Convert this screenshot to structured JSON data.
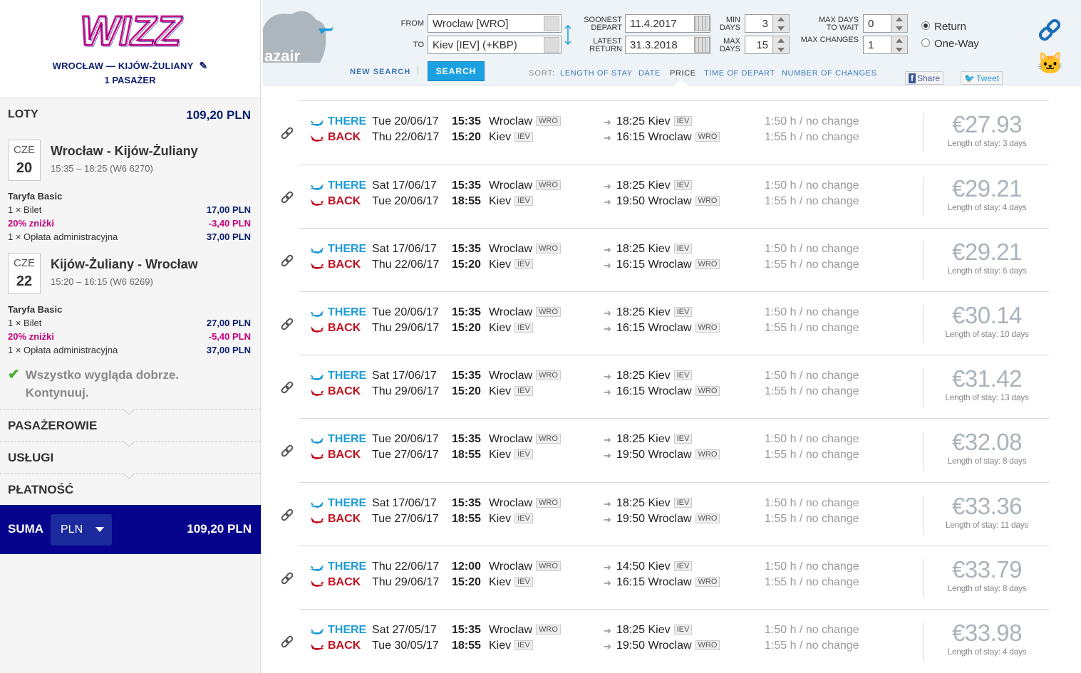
{
  "wizz": {
    "logo_text": "WIZZ",
    "route": "WROCŁAW — KIJÓW-ŻULIANY",
    "passengers": "1 PASAŻER",
    "flights_label": "LOTY",
    "flights_total": "109,20 PLN",
    "legs": [
      {
        "dow": "CZE",
        "day": "20",
        "title": "Wrocław - Kijów-Żuliany",
        "subtitle": "15:35 – 18:25 (W6 6270)",
        "fare_name": "Taryfa Basic",
        "lines": [
          {
            "label": "1 × Bilet",
            "value": "17,00 PLN"
          },
          {
            "label": "20% zniżki",
            "value": "-3,40 PLN"
          },
          {
            "label": "1 × Opłata administracyjna",
            "value": "37,00 PLN"
          }
        ]
      },
      {
        "dow": "CZE",
        "day": "22",
        "title": "Kijów-Żuliany - Wrocław",
        "subtitle": "15:20 – 16:15 (W6 6269)",
        "fare_name": "Taryfa Basic",
        "lines": [
          {
            "label": "1 × Bilet",
            "value": "27,00 PLN"
          },
          {
            "label": "20% zniżki",
            "value": "-5,40 PLN"
          },
          {
            "label": "1 × Opłata administracyjna",
            "value": "37,00 PLN"
          }
        ]
      }
    ],
    "ok_message_1": "Wszystko wygląda dobrze.",
    "ok_message_2": "Kontynuuj.",
    "sections": [
      "PASAŻEROWIE",
      "USŁUGI",
      "PŁATNOŚĆ"
    ],
    "suma_label": "SUMA",
    "currency": "PLN",
    "suma_total": "109,20 PLN",
    "brand_color": "#06038d",
    "accent_color": "#c6007e"
  },
  "search": {
    "logo_text": "azair",
    "from_label": "FROM",
    "from_value": "Wroclaw [WRO]",
    "to_label": "TO",
    "to_value": "Kiev [IEV] (+KBP)",
    "soonest_label_1": "SOONEST",
    "soonest_label_2": "DEPART",
    "soonest_value": "11.4.2017",
    "latest_label_1": "LATEST",
    "latest_label_2": "RETURN",
    "latest_value": "31.3.2018",
    "min_days_label_1": "MIN",
    "min_days_label_2": "DAYS",
    "min_days": "3",
    "max_days_label_1": "MAX",
    "max_days_label_2": "DAYS",
    "max_days": "15",
    "max_wait_label_1": "MAX DAYS",
    "max_wait_label_2": "TO WAIT",
    "max_wait": "0",
    "max_changes_label": "MAX CHANGES",
    "max_changes": "1",
    "radio_return": "Return",
    "radio_oneway": "One-Way",
    "new_search": "NEW SEARCH",
    "search_button": "SEARCH",
    "sort_label": "SORT:",
    "sort_items": [
      "LENGTH OF STAY",
      "DATE",
      "PRICE",
      "TIME OF DEPART",
      "NUMBER OF CHANGES"
    ],
    "share_label": "Share",
    "tweet_label": "Tweet"
  },
  "results": [
    {
      "there": {
        "date": "Tue 20/06/17",
        "time": "15:35",
        "from": "Wroclaw",
        "from_code": "WRO",
        "atime": "18:25",
        "to": "Kiev",
        "to_code": "IEV",
        "dur": "1:50 h / no change"
      },
      "back": {
        "date": "Thu 22/06/17",
        "time": "15:20",
        "from": "Kiev",
        "from_code": "IEV",
        "atime": "16:15",
        "to": "Wroclaw",
        "to_code": "WRO",
        "dur": "1:55 h / no change"
      },
      "price": "€27.93",
      "stay": "Length of stay: 3 days"
    },
    {
      "there": {
        "date": "Sat 17/06/17",
        "time": "15:35",
        "from": "Wroclaw",
        "from_code": "WRO",
        "atime": "18:25",
        "to": "Kiev",
        "to_code": "IEV",
        "dur": "1:50 h / no change"
      },
      "back": {
        "date": "Tue 20/06/17",
        "time": "18:55",
        "from": "Kiev",
        "from_code": "IEV",
        "atime": "19:50",
        "to": "Wroclaw",
        "to_code": "WRO",
        "dur": "1:55 h / no change"
      },
      "price": "€29.21",
      "stay": "Length of stay: 4 days"
    },
    {
      "there": {
        "date": "Sat 17/06/17",
        "time": "15:35",
        "from": "Wroclaw",
        "from_code": "WRO",
        "atime": "18:25",
        "to": "Kiev",
        "to_code": "IEV",
        "dur": "1:50 h / no change"
      },
      "back": {
        "date": "Thu 22/06/17",
        "time": "15:20",
        "from": "Kiev",
        "from_code": "IEV",
        "atime": "16:15",
        "to": "Wroclaw",
        "to_code": "WRO",
        "dur": "1:55 h / no change"
      },
      "price": "€29.21",
      "stay": "Length of stay: 6 days"
    },
    {
      "there": {
        "date": "Tue 20/06/17",
        "time": "15:35",
        "from": "Wroclaw",
        "from_code": "WRO",
        "atime": "18:25",
        "to": "Kiev",
        "to_code": "IEV",
        "dur": "1:50 h / no change"
      },
      "back": {
        "date": "Thu 29/06/17",
        "time": "15:20",
        "from": "Kiev",
        "from_code": "IEV",
        "atime": "16:15",
        "to": "Wroclaw",
        "to_code": "WRO",
        "dur": "1:55 h / no change"
      },
      "price": "€30.14",
      "stay": "Length of stay: 10 days"
    },
    {
      "there": {
        "date": "Sat 17/06/17",
        "time": "15:35",
        "from": "Wroclaw",
        "from_code": "WRO",
        "atime": "18:25",
        "to": "Kiev",
        "to_code": "IEV",
        "dur": "1:50 h / no change"
      },
      "back": {
        "date": "Thu 29/06/17",
        "time": "15:20",
        "from": "Kiev",
        "from_code": "IEV",
        "atime": "16:15",
        "to": "Wroclaw",
        "to_code": "WRO",
        "dur": "1:55 h / no change"
      },
      "price": "€31.42",
      "stay": "Length of stay: 13 days"
    },
    {
      "there": {
        "date": "Tue 20/06/17",
        "time": "15:35",
        "from": "Wroclaw",
        "from_code": "WRO",
        "atime": "18:25",
        "to": "Kiev",
        "to_code": "IEV",
        "dur": "1:50 h / no change"
      },
      "back": {
        "date": "Tue 27/06/17",
        "time": "18:55",
        "from": "Kiev",
        "from_code": "IEV",
        "atime": "19:50",
        "to": "Wroclaw",
        "to_code": "WRO",
        "dur": "1:55 h / no change"
      },
      "price": "€32.08",
      "stay": "Length of stay: 8 days"
    },
    {
      "there": {
        "date": "Sat 17/06/17",
        "time": "15:35",
        "from": "Wroclaw",
        "from_code": "WRO",
        "atime": "18:25",
        "to": "Kiev",
        "to_code": "IEV",
        "dur": "1:50 h / no change"
      },
      "back": {
        "date": "Tue 27/06/17",
        "time": "18:55",
        "from": "Kiev",
        "from_code": "IEV",
        "atime": "19:50",
        "to": "Wroclaw",
        "to_code": "WRO",
        "dur": "1:55 h / no change"
      },
      "price": "€33.36",
      "stay": "Length of stay: 11 days"
    },
    {
      "there": {
        "date": "Thu 22/06/17",
        "time": "12:00",
        "from": "Wroclaw",
        "from_code": "WRO",
        "atime": "14:50",
        "to": "Kiev",
        "to_code": "IEV",
        "dur": "1:50 h / no change"
      },
      "back": {
        "date": "Thu 29/06/17",
        "time": "15:20",
        "from": "Kiev",
        "from_code": "IEV",
        "atime": "16:15",
        "to": "Wroclaw",
        "to_code": "WRO",
        "dur": "1:55 h / no change"
      },
      "price": "€33.79",
      "stay": "Length of stay: 8 days"
    },
    {
      "there": {
        "date": "Sat 27/05/17",
        "time": "15:35",
        "from": "Wroclaw",
        "from_code": "WRO",
        "atime": "18:25",
        "to": "Kiev",
        "to_code": "IEV",
        "dur": "1:50 h / no change"
      },
      "back": {
        "date": "Tue 30/05/17",
        "time": "18:55",
        "from": "Kiev",
        "from_code": "IEV",
        "atime": "19:50",
        "to": "Wroclaw",
        "to_code": "WRO",
        "dur": "1:55 h / no change"
      },
      "price": "€33.98",
      "stay": "Length of stay: 4 days"
    }
  ],
  "labels": {
    "there": "THERE",
    "back": "BACK"
  }
}
